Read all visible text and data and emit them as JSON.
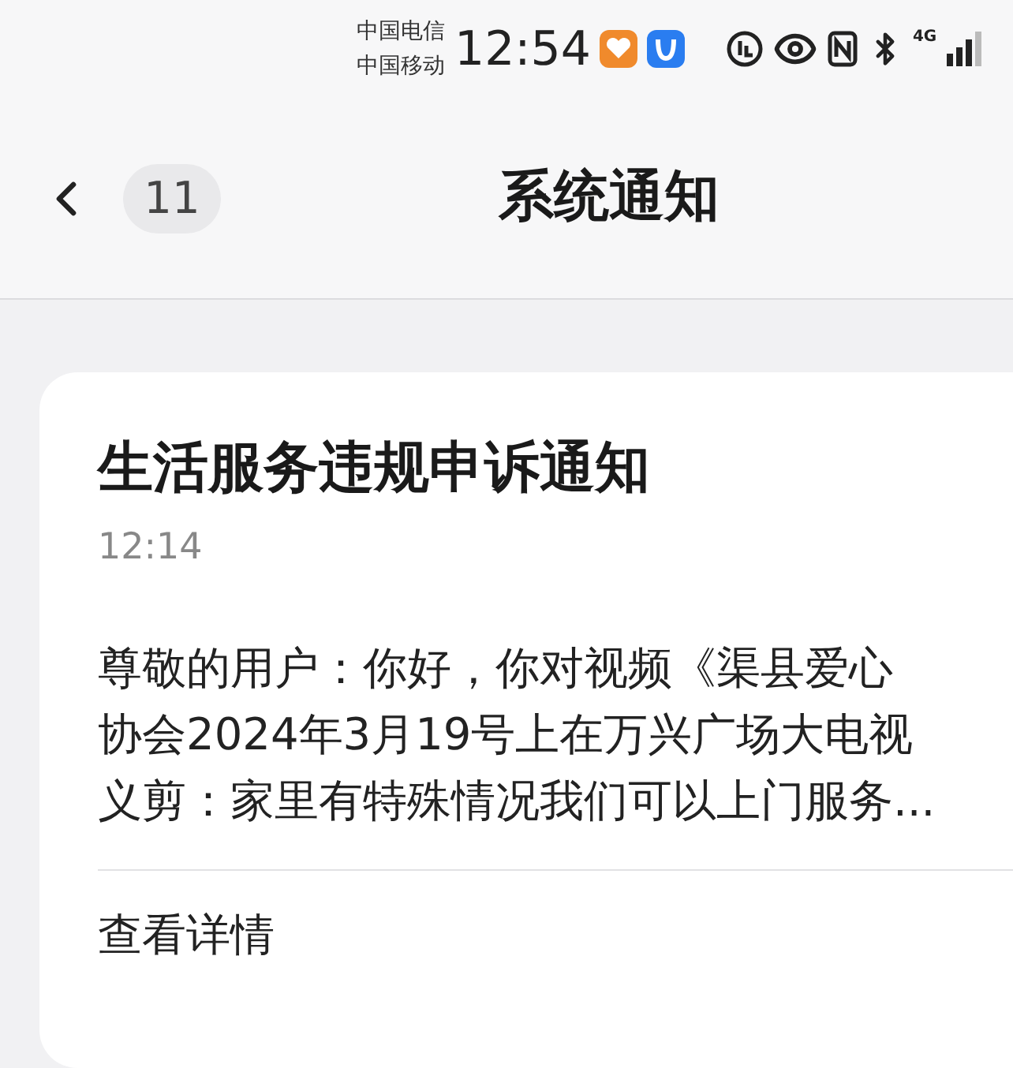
{
  "status_bar": {
    "carriers": [
      "中国电信",
      "中国移动"
    ],
    "time": "12:54",
    "network": "4G"
  },
  "header": {
    "unread_count": "11",
    "title": "系统通知"
  },
  "notification": {
    "title": "生活服务违规申诉通知",
    "time": "12:14",
    "body_lines": [
      "尊敬的用户：你好，你对视频《渠县爱心",
      "协会2024年3月19号上在万兴广场大电视",
      "义剪：家里有特殊情况我们可以上门服务..."
    ],
    "action": "查看详情"
  }
}
